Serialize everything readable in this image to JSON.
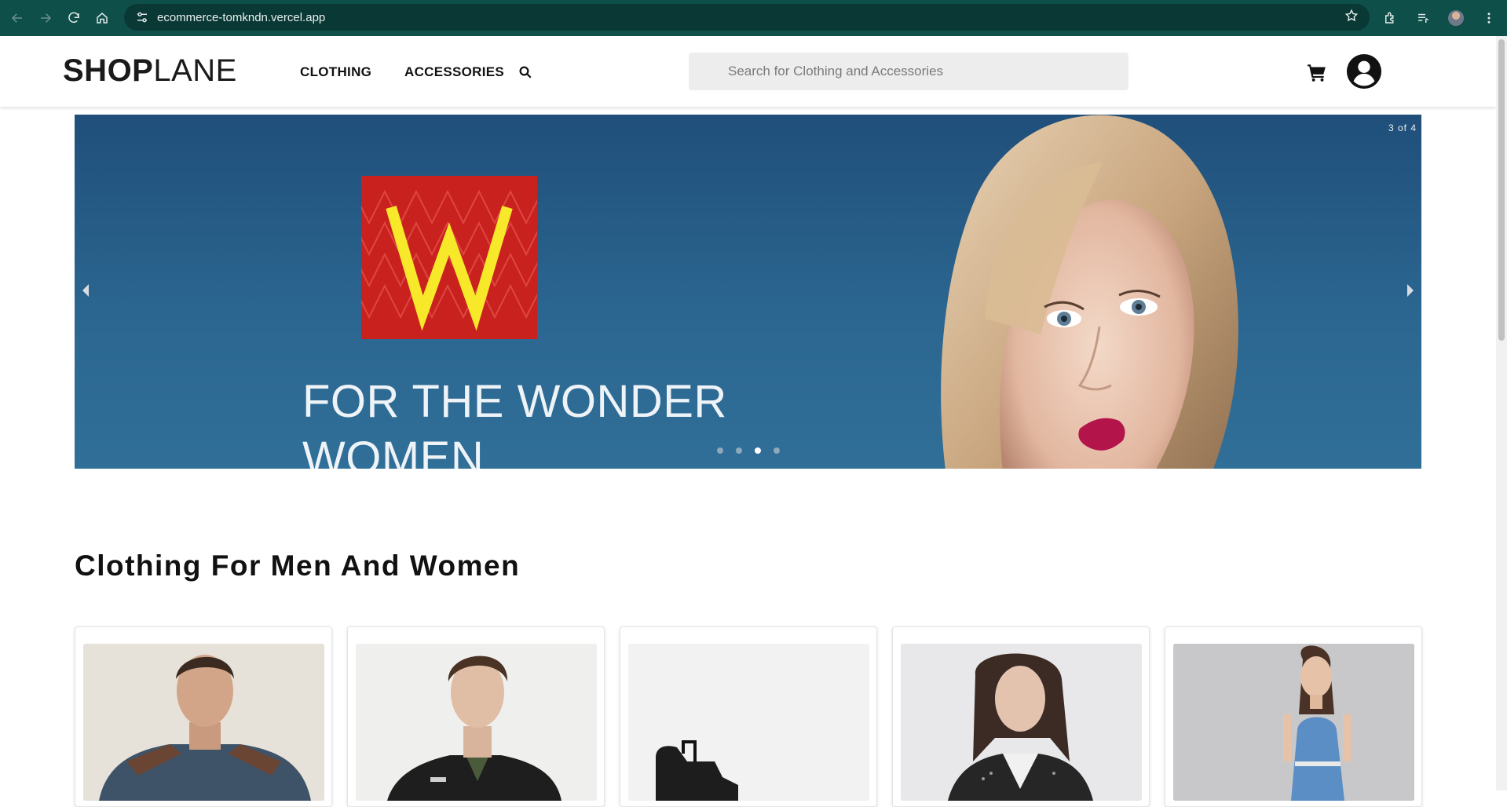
{
  "browser": {
    "url": "ecommerce-tomkndn.vercel.app"
  },
  "header": {
    "logo_bold": "SHOP",
    "logo_light": "LANE",
    "nav": [
      {
        "label": "CLOTHING"
      },
      {
        "label": "ACCESSORIES"
      }
    ],
    "search_placeholder": "Search for Clothing and Accessories"
  },
  "carousel": {
    "counter": "3 of 4",
    "brand_letter": "W",
    "slide_text_line1": "FOR THE WONDER",
    "slide_text_line2": "WOMEN",
    "slide_count": 4,
    "active_index": 3
  },
  "section": {
    "title": "Clothing For Men And Women"
  },
  "colors": {
    "chrome": "#0f4f4a",
    "carousel_bg": "#2b6690",
    "brand_tile": "#c9211e",
    "brand_letter": "#f7e82a"
  }
}
